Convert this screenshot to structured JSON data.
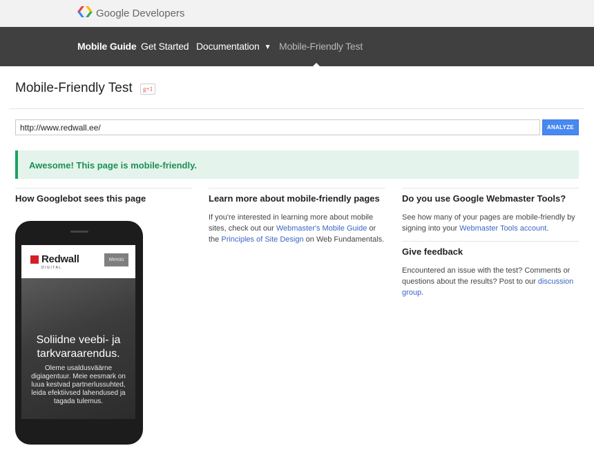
{
  "header": {
    "brand": "Google Developers"
  },
  "nav": {
    "items": [
      {
        "label": "Mobile Guide"
      },
      {
        "label": "Get Started"
      },
      {
        "label": "Documentation"
      },
      {
        "label": "Mobile-Friendly Test"
      }
    ]
  },
  "page": {
    "title": "Mobile-Friendly Test",
    "gplus_label": "g+1"
  },
  "form": {
    "url_value": "http://www.redwall.ee/",
    "analyze_label": "ANALYZE"
  },
  "result": {
    "message": "Awesome! This page is mobile-friendly."
  },
  "columns": {
    "googlebot": {
      "title": "How Googlebot sees this page"
    },
    "learn": {
      "title": "Learn more about mobile-friendly pages",
      "text1": "If you're interested in learning more about mobile sites, check out our ",
      "link1": "Webmaster's Mobile Guide",
      "text2": " or the ",
      "link2": "Principles of Site Design",
      "text3": " on Web Fundamentals."
    },
    "webmaster": {
      "title": "Do you use Google Webmaster Tools?",
      "text1": "See how many of your pages are mobile-friendly by signing into your ",
      "link1": "Webmaster Tools account",
      "text2": "."
    },
    "feedback": {
      "title": "Give feedback",
      "text1": "Encountered an issue with the test? Comments or questions about the results? Post to our ",
      "link1": "discussion group",
      "text2": "."
    }
  },
  "preview": {
    "logo_name": "Redwall",
    "logo_sub": "DIGITAL",
    "menu_label": "Menüü",
    "hero_title": "Soliidne veebi- ja tarkvaraarendus.",
    "hero_text": "Oleme usaldusväärne digiagentuur. Meie eesmark on luua kestvad partnerlussuhted, leida efektiivsed lahendused ja tagada tulemus."
  },
  "colors": {
    "nav_bg": "#404040",
    "analyze_bg": "#4889f1",
    "success_bg": "#e4f4ec",
    "success_text": "#1a8f55",
    "link": "#3b66c2",
    "redwall_red": "#d41f26"
  }
}
